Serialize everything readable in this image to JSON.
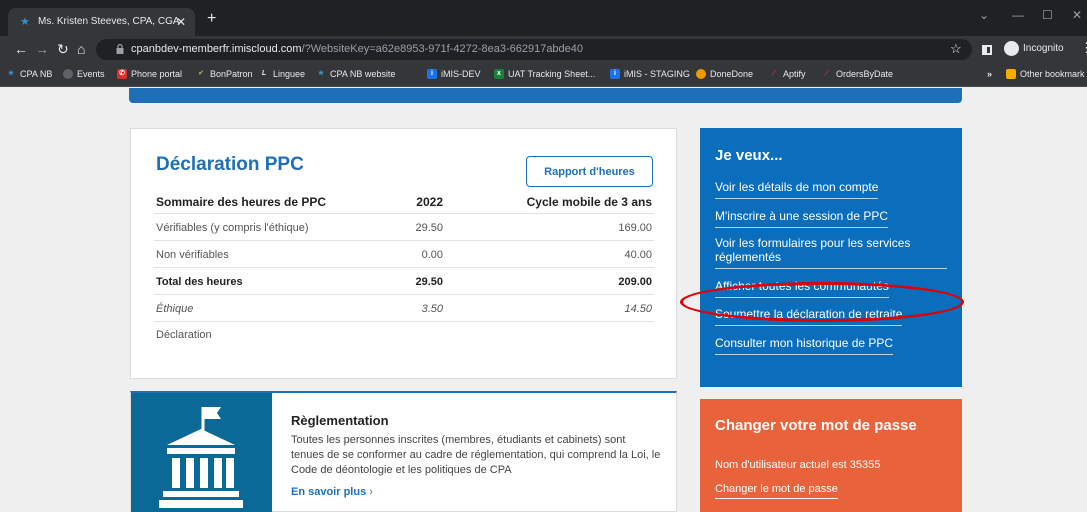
{
  "browser": {
    "tab_title": "Ms. Kristen Steeves, CPA, CGA",
    "url_host": "cpanbdev-memberfr.imiscloud.com",
    "url_path": "/?WebsiteKey=a62e8953-971f-4272-8ea3-662917abde40",
    "incognito_label": "Incognito",
    "bookmarks": [
      {
        "label": "CPA NB",
        "icon": "cpa-star-icon",
        "color": "#3b8ed0"
      },
      {
        "label": "Events",
        "icon": "globe-icon",
        "color": "#9aa0a6"
      },
      {
        "label": "Phone portal",
        "icon": "phone-portal-icon",
        "color": "#d93025"
      },
      {
        "label": "BonPatron",
        "icon": "bonpatron-icon",
        "color": "#7cb342"
      },
      {
        "label": "Linguee",
        "icon": "linguee-icon",
        "color": "#e8eaed"
      },
      {
        "label": "CPA NB website",
        "icon": "cpa-star-icon",
        "color": "#3b8ed0"
      },
      {
        "label": "iMIS-DEV",
        "icon": "imis-icon",
        "color": "#1a73e8"
      },
      {
        "label": "UAT Tracking Sheet...",
        "icon": "excel-icon",
        "color": "#188038"
      },
      {
        "label": "iMIS - STAGING",
        "icon": "imis-icon",
        "color": "#1a73e8"
      },
      {
        "label": "DoneDone",
        "icon": "donedone-icon",
        "color": "#f29900"
      },
      {
        "label": "Aptify",
        "icon": "aptify-icon",
        "color": "#c0392b"
      },
      {
        "label": "OrdersByDate",
        "icon": "aptify-icon",
        "color": "#c0392b"
      }
    ],
    "overflow_label": "»",
    "other_bookmarks_label": "Other bookmark"
  },
  "declaration": {
    "title": "Déclaration PPC",
    "report_button": "Rapport d'heures",
    "headers": [
      "Sommaire des heures de PPC",
      "2022",
      "Cycle mobile de 3 ans"
    ],
    "rows": [
      {
        "label": "Vérifiables (y compris l'éthique)",
        "year": "29.50",
        "cycle": "169.00"
      },
      {
        "label": "Non vérifiables",
        "year": "0.00",
        "cycle": "40.00"
      },
      {
        "label": "Total des heures",
        "year": "29.50",
        "cycle": "209.00"
      },
      {
        "label": "Éthique",
        "year": "3.50",
        "cycle": "14.50"
      },
      {
        "label": "Déclaration",
        "year": "",
        "cycle": ""
      }
    ]
  },
  "reglementation": {
    "title": "Règlementation",
    "body": "Toutes les personnes inscrites (membres, étudiants et cabinets) sont tenues de se conformer au cadre de réglementation, qui comprend la Loi, le Code de déontologie et les politiques de CPA",
    "link": "En savoir plus",
    "link_arrow": "›"
  },
  "jeveux": {
    "title": "Je veux...",
    "links": [
      "Voir les détails de mon compte",
      "M'inscrire à une session de PPC",
      "Voir les formulaires pour les services réglementés",
      "Afficher toutes les communautés",
      "Soumettre la déclaration de retraite",
      "Consulter mon historique de PPC"
    ]
  },
  "password": {
    "title": "Changer votre mot de passe",
    "current_user": "Nom d'utilisateur actuel est  35355",
    "link": "Changer le mot de passe"
  },
  "colors": {
    "brand_blue": "#1e6fb8",
    "panel_blue": "#0a6ebd",
    "orange": "#e8633b",
    "highlight_red": "#e00000"
  }
}
